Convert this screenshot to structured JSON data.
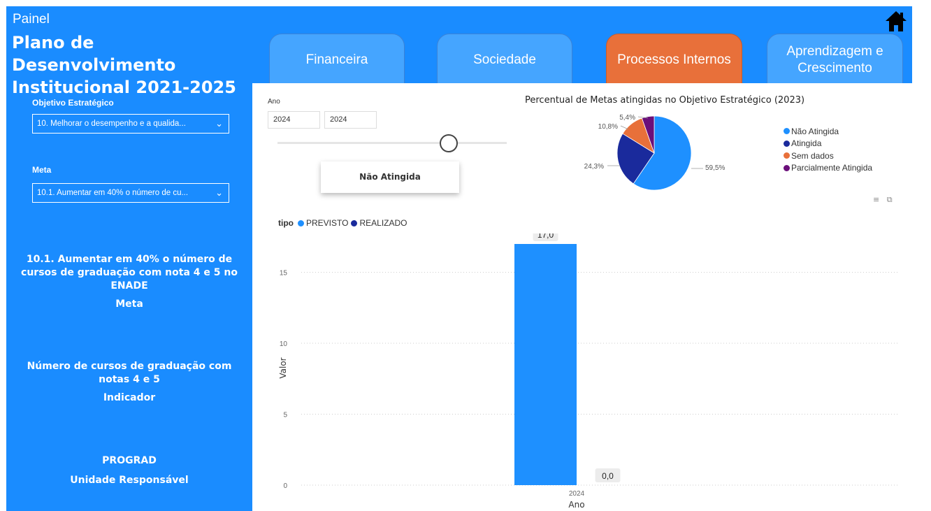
{
  "sidebar": {
    "app_label": "Painel",
    "title": "Plano de Desenvolvimento Institucional 2021-2025",
    "objetivo_label": "Objetivo Estratégico",
    "objetivo_value": "10. Melhorar o desempenho e a qualida...",
    "meta_label": "Meta",
    "meta_value": "10.1. Aumentar em 40% o número de cu...",
    "cards": [
      {
        "value": "10.1. Aumentar em 40% o número de cursos de graduação com nota 4 e 5 no ENADE",
        "label": "Meta"
      },
      {
        "value": "Número de cursos de graduação com notas 4 e 5",
        "label": "Indicador"
      },
      {
        "value": "PROGRAD",
        "label": "Unidade Responsável"
      }
    ]
  },
  "icons": {
    "home": "home-icon",
    "chevron": "chevron-down-icon"
  },
  "tabs": [
    {
      "label": "Financeira",
      "active": false
    },
    {
      "label": "Sociedade",
      "active": false
    },
    {
      "label": "Processos Internos",
      "active": true
    },
    {
      "label": "Aprendizagem e Crescimento",
      "active": false
    }
  ],
  "ano_filter": {
    "label": "Ano",
    "from": "2024",
    "to": "2024"
  },
  "status_card": "Não Atingida",
  "colors": {
    "primary": "#1a8cff",
    "tab": "#45a5ff",
    "tab_active": "#e8703a",
    "nao_atingida": "#1e90ff",
    "atingida": "#1a2a9c",
    "sem_dados": "#e8703a",
    "parcial": "#6b0f7a"
  },
  "chart_data": [
    {
      "type": "pie",
      "title": "Percentual de Metas atingidas no Objetivo Estratégico (2023)",
      "slices": [
        {
          "name": "Não Atingida",
          "value": 59.5,
          "label": "59,5%",
          "color": "#1e90ff"
        },
        {
          "name": "Atingida",
          "value": 24.3,
          "label": "24,3%",
          "color": "#1a2a9c"
        },
        {
          "name": "Sem dados",
          "value": 10.8,
          "label": "10,8%",
          "color": "#e8703a"
        },
        {
          "name": "Parcialmente Atingida",
          "value": 5.4,
          "label": "5,4%",
          "color": "#6b0f7a"
        }
      ],
      "legend_placement": "right"
    },
    {
      "type": "bar",
      "legend_title": "tipo",
      "categories": [
        "2024"
      ],
      "series": [
        {
          "name": "PREVISTO",
          "values": [
            17.0
          ],
          "labels": [
            "17,0"
          ],
          "color": "#1e90ff"
        },
        {
          "name": "REALIZADO",
          "values": [
            0.0
          ],
          "labels": [
            "0,0"
          ],
          "color": "#1a2a9c"
        }
      ],
      "xlabel": "Ano",
      "ylabel": "Valor",
      "ylim": [
        0,
        17
      ],
      "yticks": [
        "0",
        "5",
        "10",
        "15"
      ],
      "grid": true,
      "legend_placement": "top-left"
    }
  ]
}
